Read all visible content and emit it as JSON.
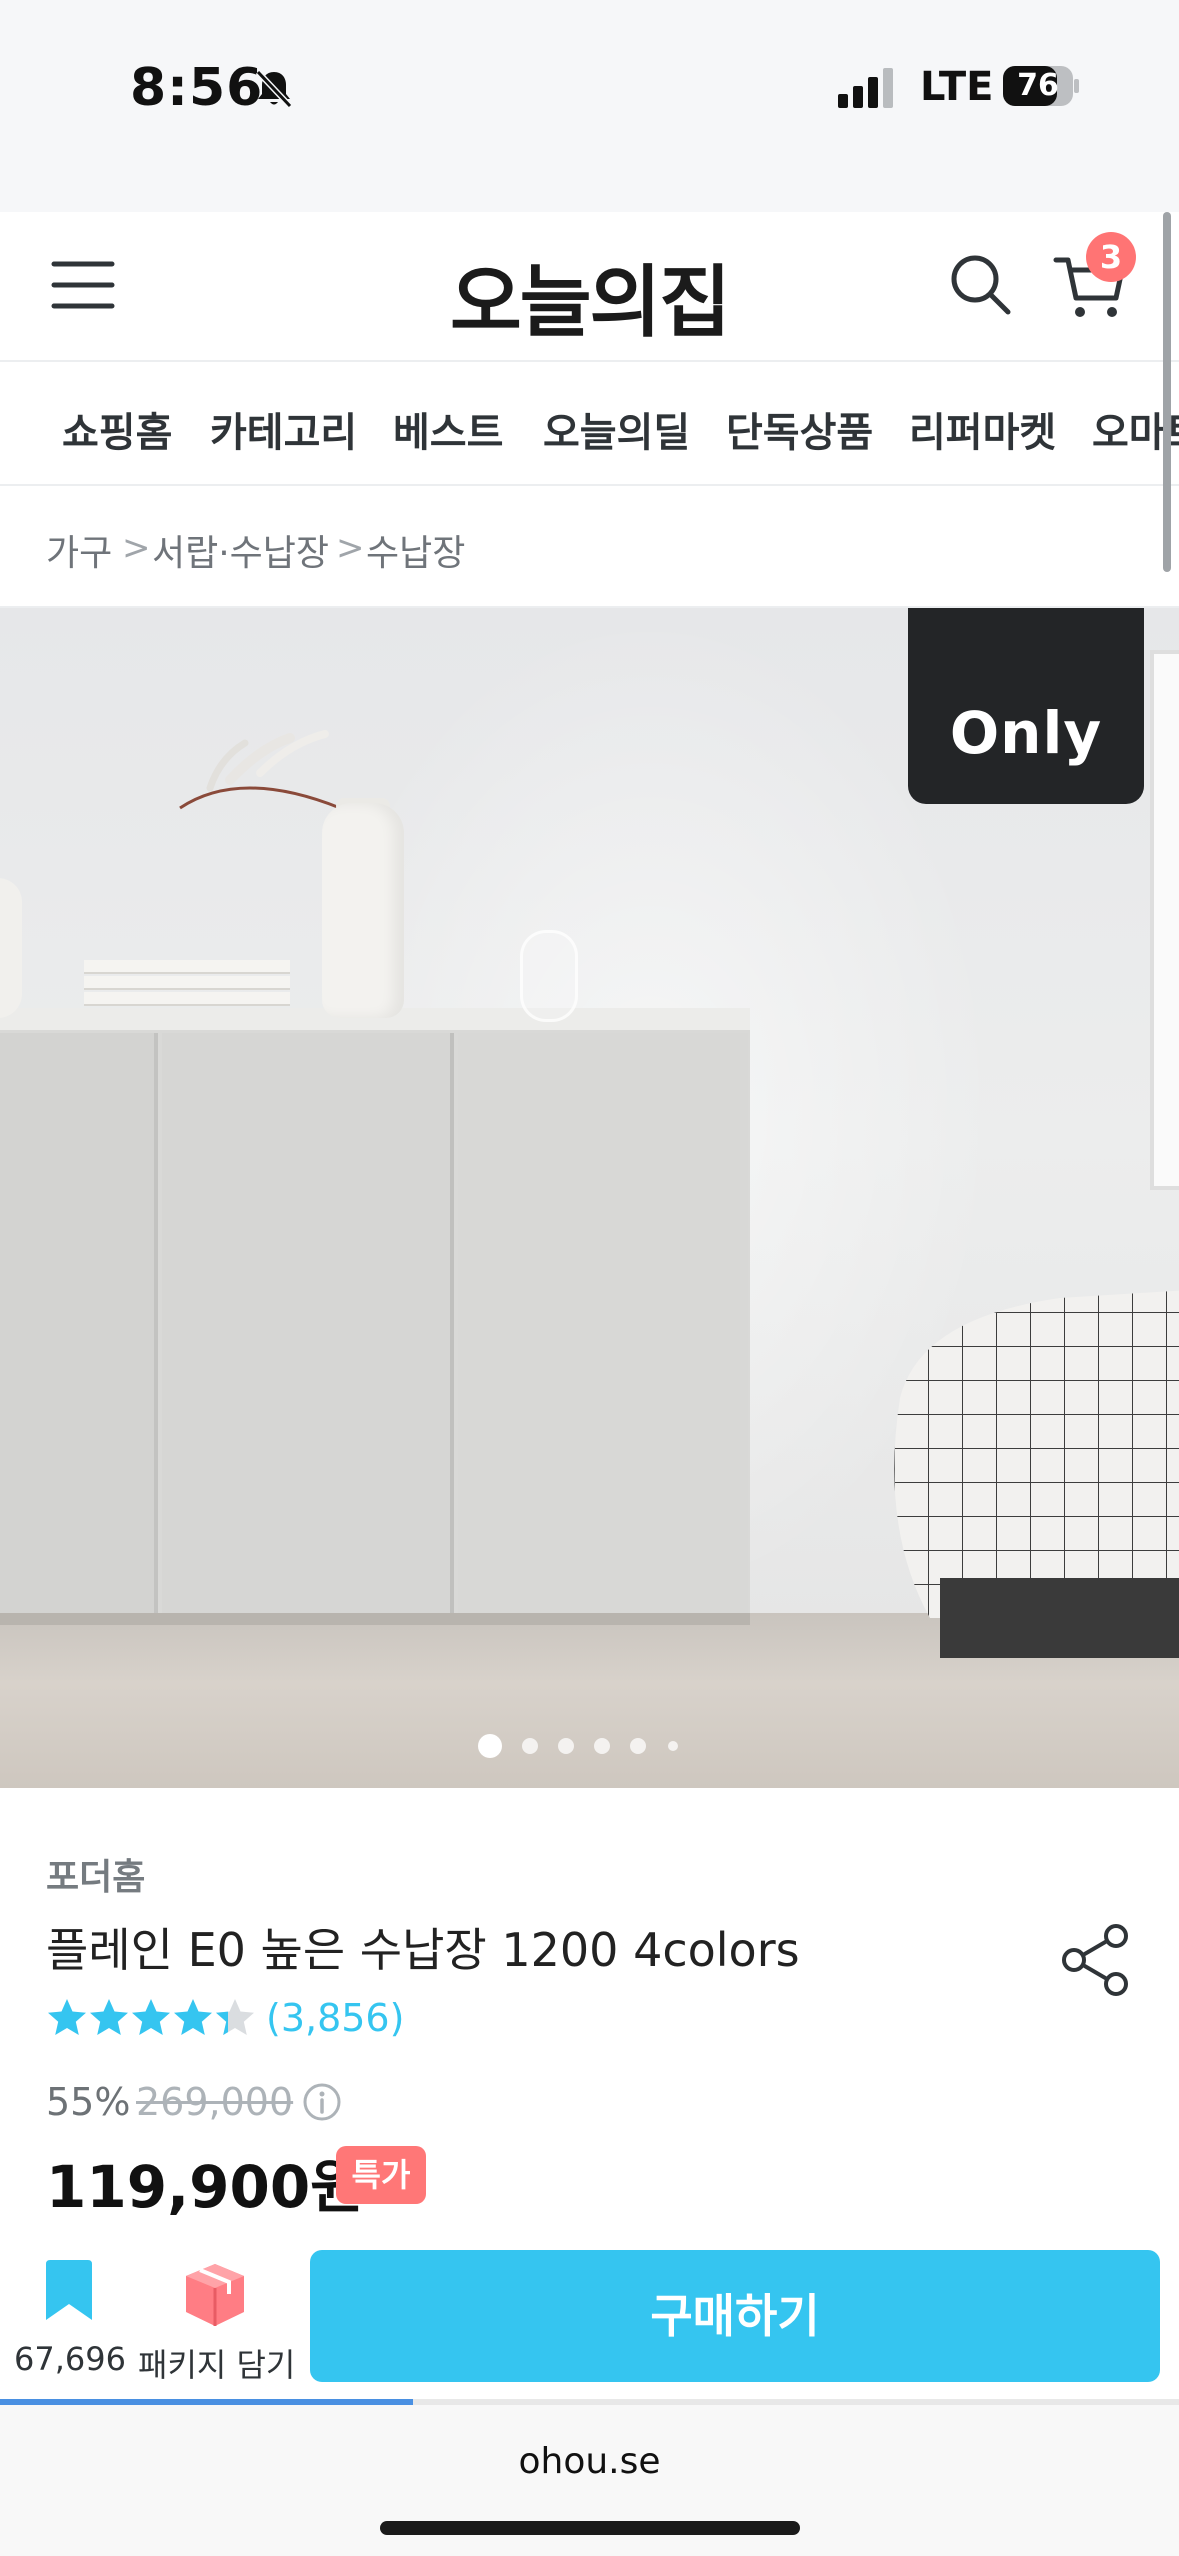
{
  "status_bar": {
    "time": "8:56",
    "network": "LTE",
    "battery": "76",
    "icons": [
      "bell-slash-icon",
      "signal-icon",
      "battery-icon"
    ]
  },
  "header": {
    "logo": "오늘의집",
    "cart_count": "3",
    "icons": [
      "menu-icon",
      "search-icon",
      "cart-icon"
    ]
  },
  "nav": {
    "items": [
      {
        "label": "쇼핑홈"
      },
      {
        "label": "카테고리"
      },
      {
        "label": "베스트"
      },
      {
        "label": "오늘의딜"
      },
      {
        "label": "단독상품"
      },
      {
        "label": "리퍼마켓"
      },
      {
        "label": "오마트"
      }
    ]
  },
  "breadcrumb": {
    "items": [
      {
        "label": "가구"
      },
      {
        "label": "서랍·수납장"
      },
      {
        "label": "수납장"
      }
    ],
    "separator": ">"
  },
  "hero": {
    "badge": "Only",
    "slide_count": 6,
    "active_slide": 1
  },
  "product": {
    "brand": "포더홈",
    "title": "플레인 E0 높은 수납장 1200 4colors",
    "rating": 4.5,
    "reviews": "(3,856)",
    "discount": "55%",
    "original_price": "269,000",
    "price": "119,900원",
    "special_badge": "특가"
  },
  "action_bar": {
    "bookmark_count": "67,696",
    "package_label": "패키지 담기",
    "buy_label": "구매하기"
  },
  "browser": {
    "url": "ohou.se",
    "load_progress": 0.35
  },
  "colors": {
    "accent": "#35c5f0",
    "badge_red": "#ff7777",
    "text_dark": "#2f3438"
  }
}
